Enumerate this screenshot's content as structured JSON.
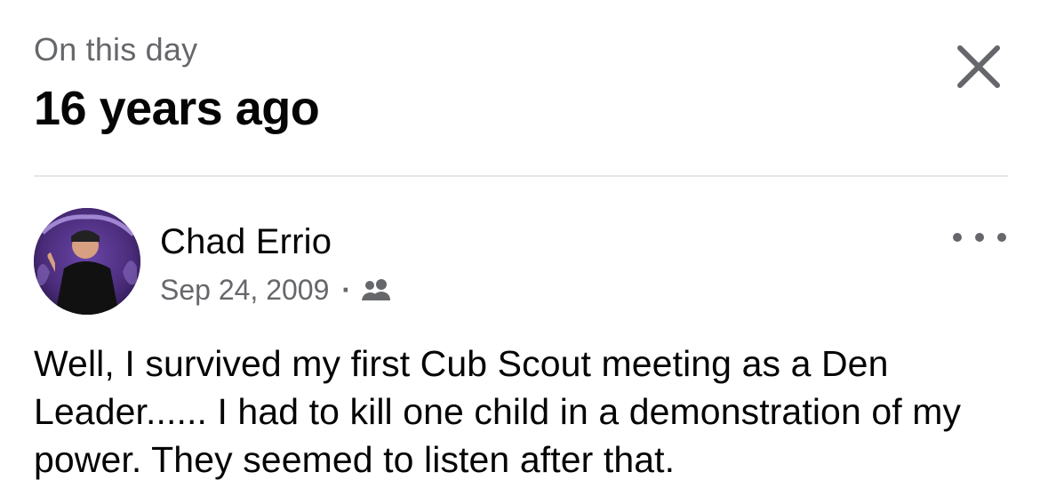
{
  "memory": {
    "kicker": "On this day",
    "title": "16 years ago",
    "close_icon": "close-icon"
  },
  "post": {
    "author": "Chad Errio",
    "date": "Sep 24, 2009",
    "separator": "·",
    "audience_icon": "friends-icon",
    "more_icon": "more-options-icon",
    "text": "Well, I survived my first Cub Scout meeting as a Den Leader...... I had to kill one child in a demonstration of my power. They seemed to listen after that."
  },
  "colors": {
    "primary_text": "#050505",
    "secondary_text": "#65676b",
    "divider": "#e4e6eb",
    "avatar_accent": "#4a2c7a"
  }
}
